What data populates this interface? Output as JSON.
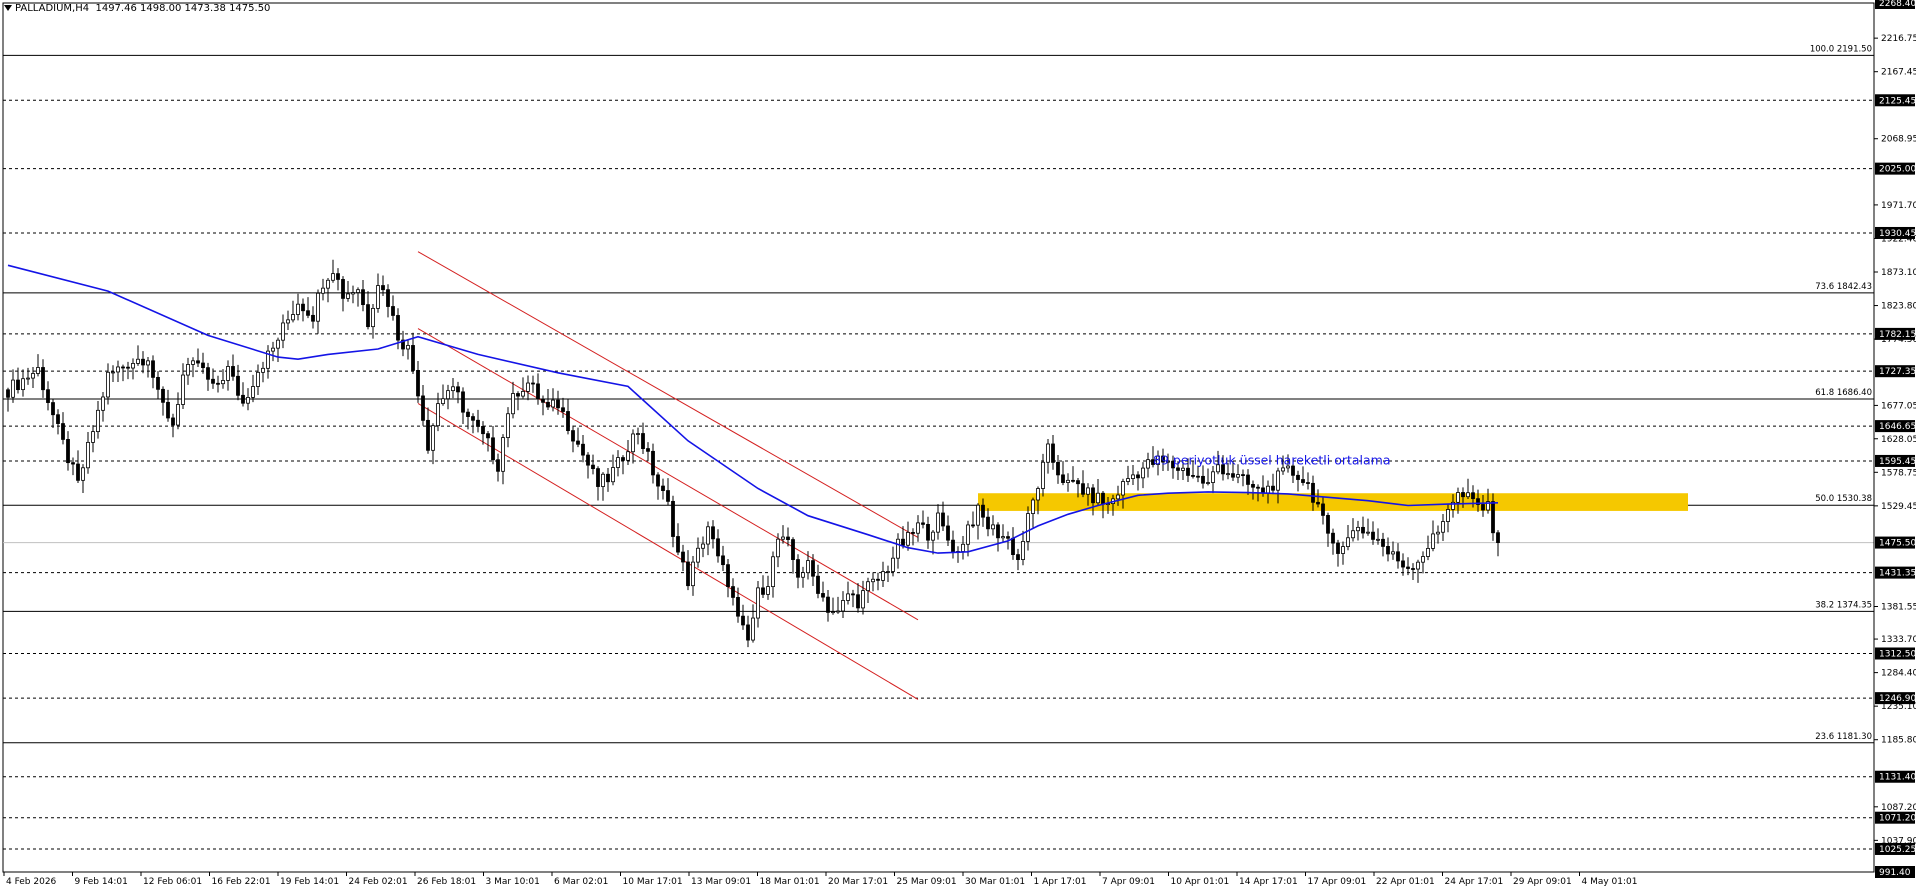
{
  "header": {
    "symbol": "PALLADIUM,H4",
    "ohlc": "1497.46 1498.00 1473.38 1475.50"
  },
  "annotation": {
    "ema_label": "89 periyotluk üssel hareketli ortalama"
  },
  "colors": {
    "background": "#ffffff",
    "candle": "#000000",
    "ema": "#1414e6",
    "channel": "#d42020",
    "zone": "#f5c800",
    "grid": "#000000",
    "text": "#000000"
  },
  "chart_data": {
    "type": "candlestick",
    "title": "",
    "ylim": [
      991.4,
      2268.4
    ],
    "y_axis_ticks": [
      "2216.75",
      "2167.45",
      "2068.95",
      "1971.70",
      "1922.40",
      "1873.10",
      "1823.80",
      "1774.50",
      "1677.05",
      "1628.05",
      "1578.75",
      "1529.45",
      "1381.55",
      "1333.70",
      "1284.40",
      "1235.10",
      "1185.80",
      "1087.20",
      "1037.90"
    ],
    "price_labels": [
      "2268.40",
      "2125.45",
      "2025.00",
      "1930.45",
      "1782.15",
      "1727.35",
      "1646.65",
      "1595.45",
      "1475.50",
      "1431.35",
      "1312.50",
      "1246.90",
      "1131.40",
      "1071.20",
      "1025.25",
      "991.40"
    ],
    "horizontal_levels_dashed": [
      2268.4,
      2125.45,
      2025.0,
      1930.45,
      1782.15,
      1727.35,
      1646.65,
      1595.45,
      1431.35,
      1312.5,
      1246.9,
      1131.4,
      1071.2,
      1025.25
    ],
    "current_price": 1475.5,
    "fibonacci": [
      {
        "level": "100.0",
        "price": 2191.5,
        "label": "100.0 2191.50"
      },
      {
        "level": "73.6",
        "price": 1842.43,
        "label": "73.6 1842.43"
      },
      {
        "level": "61.8",
        "price": 1686.4,
        "label": "61.8 1686.40"
      },
      {
        "level": "50.0",
        "price": 1530.38,
        "label": "50.0 1530.38"
      },
      {
        "level": "38.2",
        "price": 1374.35,
        "label": "38.2 1374.35"
      },
      {
        "level": "23.6",
        "price": 1181.3,
        "label": "23.6 1181.30"
      }
    ],
    "x_labels": [
      "4 Feb 2026",
      "9 Feb 14:01",
      "12 Feb 06:01",
      "16 Feb 22:01",
      "19 Feb 14:01",
      "24 Feb 02:01",
      "26 Feb 18:01",
      "3 Mar 10:01",
      "6 Mar 02:01",
      "10 Mar 17:01",
      "13 Mar 09:01",
      "18 Mar 01:01",
      "20 Mar 17:01",
      "25 Mar 09:01",
      "30 Mar 01:01",
      "1 Apr 17:01",
      "7 Apr 09:01",
      "10 Apr 01:01",
      "14 Apr 17:01",
      "17 Apr 09:01",
      "22 Apr 01:01",
      "24 Apr 17:01",
      "29 Apr 09:01",
      "4 May 01:01"
    ],
    "price_path": [
      [
        0,
        1700
      ],
      [
        6,
        1730
      ],
      [
        10,
        1640
      ],
      [
        14,
        1560
      ],
      [
        17,
        1640
      ],
      [
        20,
        1720
      ],
      [
        24,
        1740
      ],
      [
        28,
        1750
      ],
      [
        30,
        1690
      ],
      [
        33,
        1650
      ],
      [
        35,
        1720
      ],
      [
        38,
        1740
      ],
      [
        41,
        1700
      ],
      [
        44,
        1730
      ],
      [
        47,
        1680
      ],
      [
        50,
        1730
      ],
      [
        53,
        1760
      ],
      [
        55,
        1790
      ],
      [
        58,
        1830
      ],
      [
        61,
        1810
      ],
      [
        63,
        1860
      ],
      [
        65,
        1880
      ],
      [
        67,
        1840
      ],
      [
        70,
        1850
      ],
      [
        72,
        1800
      ],
      [
        74,
        1860
      ],
      [
        76,
        1830
      ],
      [
        78,
        1780
      ],
      [
        80,
        1760
      ],
      [
        82,
        1700
      ],
      [
        84,
        1620
      ],
      [
        86,
        1680
      ],
      [
        88,
        1700
      ],
      [
        90,
        1690
      ],
      [
        92,
        1660
      ],
      [
        94,
        1640
      ],
      [
        96,
        1620
      ],
      [
        98,
        1590
      ],
      [
        100,
        1670
      ],
      [
        102,
        1700
      ],
      [
        104,
        1710
      ],
      [
        106,
        1690
      ],
      [
        108,
        1670
      ],
      [
        110,
        1680
      ],
      [
        112,
        1650
      ],
      [
        114,
        1620
      ],
      [
        116,
        1590
      ],
      [
        118,
        1560
      ],
      [
        120,
        1570
      ],
      [
        122,
        1590
      ],
      [
        124,
        1620
      ],
      [
        126,
        1640
      ],
      [
        128,
        1600
      ],
      [
        130,
        1560
      ],
      [
        132,
        1530
      ],
      [
        134,
        1460
      ],
      [
        136,
        1420
      ],
      [
        138,
        1460
      ],
      [
        140,
        1500
      ],
      [
        142,
        1450
      ],
      [
        144,
        1420
      ],
      [
        146,
        1360
      ],
      [
        148,
        1330
      ],
      [
        150,
        1400
      ],
      [
        152,
        1420
      ],
      [
        154,
        1480
      ],
      [
        156,
        1470
      ],
      [
        158,
        1430
      ],
      [
        160,
        1440
      ],
      [
        162,
        1410
      ],
      [
        164,
        1380
      ],
      [
        166,
        1370
      ],
      [
        168,
        1400
      ],
      [
        170,
        1390
      ],
      [
        172,
        1410
      ],
      [
        174,
        1420
      ],
      [
        176,
        1440
      ],
      [
        178,
        1470
      ],
      [
        180,
        1480
      ],
      [
        182,
        1500
      ],
      [
        184,
        1490
      ],
      [
        186,
        1510
      ],
      [
        188,
        1480
      ],
      [
        190,
        1460
      ],
      [
        192,
        1500
      ],
      [
        194,
        1520
      ],
      [
        196,
        1500
      ],
      [
        198,
        1490
      ],
      [
        200,
        1480
      ],
      [
        202,
        1450
      ],
      [
        204,
        1510
      ],
      [
        206,
        1560
      ],
      [
        208,
        1610
      ],
      [
        210,
        1580
      ],
      [
        212,
        1560
      ],
      [
        214,
        1560
      ],
      [
        216,
        1545
      ],
      [
        218,
        1540
      ],
      [
        220,
        1530
      ],
      [
        222,
        1550
      ],
      [
        224,
        1570
      ],
      [
        226,
        1580
      ],
      [
        228,
        1590
      ],
      [
        230,
        1595
      ],
      [
        232,
        1590
      ],
      [
        234,
        1585
      ],
      [
        236,
        1580
      ],
      [
        238,
        1570
      ],
      [
        240,
        1560
      ],
      [
        242,
        1590
      ],
      [
        244,
        1580
      ],
      [
        246,
        1570
      ],
      [
        248,
        1560
      ],
      [
        250,
        1550
      ],
      [
        252,
        1555
      ],
      [
        254,
        1570
      ],
      [
        256,
        1580
      ],
      [
        258,
        1575
      ],
      [
        260,
        1560
      ],
      [
        262,
        1530
      ],
      [
        264,
        1480
      ],
      [
        266,
        1470
      ],
      [
        268,
        1480
      ],
      [
        270,
        1500
      ],
      [
        272,
        1490
      ],
      [
        274,
        1480
      ],
      [
        276,
        1460
      ],
      [
        278,
        1450
      ],
      [
        280,
        1440
      ],
      [
        282,
        1450
      ],
      [
        284,
        1470
      ],
      [
        286,
        1490
      ],
      [
        288,
        1530
      ],
      [
        290,
        1545
      ],
      [
        292,
        1540
      ],
      [
        294,
        1530
      ],
      [
        296,
        1525
      ],
      [
        298,
        1475.5
      ]
    ],
    "ema_89": [
      [
        0,
        1883
      ],
      [
        20,
        1845
      ],
      [
        40,
        1780
      ],
      [
        54,
        1748
      ],
      [
        58,
        1745
      ],
      [
        64,
        1752
      ],
      [
        74,
        1760
      ],
      [
        82,
        1778
      ],
      [
        94,
        1752
      ],
      [
        110,
        1725
      ],
      [
        124,
        1705
      ],
      [
        136,
        1625
      ],
      [
        150,
        1555
      ],
      [
        160,
        1515
      ],
      [
        172,
        1487
      ],
      [
        180,
        1468
      ],
      [
        186,
        1460
      ],
      [
        192,
        1462
      ],
      [
        200,
        1478
      ],
      [
        206,
        1500
      ],
      [
        212,
        1517
      ],
      [
        218,
        1530
      ],
      [
        226,
        1545
      ],
      [
        232,
        1548
      ],
      [
        240,
        1550
      ],
      [
        248,
        1549
      ],
      [
        256,
        1547
      ],
      [
        264,
        1542
      ],
      [
        272,
        1537
      ],
      [
        280,
        1530
      ],
      [
        288,
        1532
      ],
      [
        298,
        1534
      ]
    ],
    "channel_lines": [
      [
        [
          82,
          1903
        ],
        [
          182,
          1483
        ]
      ],
      [
        [
          82,
          1790
        ],
        [
          182,
          1362
        ]
      ],
      [
        [
          82,
          1680
        ],
        [
          182,
          1245
        ]
      ]
    ],
    "zone": {
      "x_from": 194,
      "x_to": 336,
      "y_from": 1522,
      "y_to": 1548
    }
  }
}
